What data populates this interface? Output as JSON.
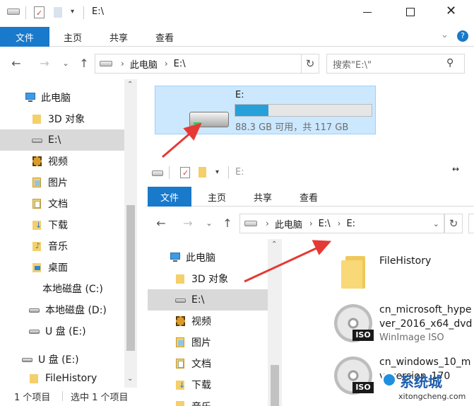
{
  "back_window": {
    "title": "E:\\",
    "tabs": [
      "文件",
      "主页",
      "共享",
      "查看"
    ],
    "address": [
      "此电脑",
      "E:\\"
    ],
    "search_placeholder": "搜索\"E:\\\"",
    "tree": [
      {
        "label": "此电脑",
        "icon": "computer-icon"
      },
      {
        "label": "3D 对象",
        "icon": "3d-objects-folder-icon"
      },
      {
        "label": "E:\\",
        "icon": "drive-icon",
        "selected": true
      },
      {
        "label": "视频",
        "icon": "videos-folder-icon"
      },
      {
        "label": "图片",
        "icon": "pictures-folder-icon"
      },
      {
        "label": "文档",
        "icon": "documents-folder-icon"
      },
      {
        "label": "下载",
        "icon": "downloads-folder-icon"
      },
      {
        "label": "音乐",
        "icon": "music-folder-icon"
      },
      {
        "label": "桌面",
        "icon": "desktop-folder-icon"
      },
      {
        "label": "本地磁盘 (C:)",
        "icon": "windows-drive-icon"
      },
      {
        "label": "本地磁盘 (D:)",
        "icon": "drive-icon"
      },
      {
        "label": "U 盘 (E:)",
        "icon": "usb-drive-icon"
      },
      {
        "label": "U 盘 (E:)",
        "icon": "usb-drive-icon"
      },
      {
        "label": "FileHistory",
        "icon": "folder-icon"
      }
    ],
    "drive_tile": {
      "name": "E:",
      "usage_text": "88.3 GB 可用，共 117 GB",
      "used_fraction": 0.245
    },
    "status_count": "1 个项目",
    "status_selected": "选中 1 个项目"
  },
  "front_window": {
    "title": "E:",
    "tabs": [
      "文件",
      "主页",
      "共享",
      "查看"
    ],
    "address": [
      "此电脑",
      "E:\\",
      "E:"
    ],
    "tree": [
      {
        "label": "此电脑",
        "icon": "computer-icon"
      },
      {
        "label": "3D 对象",
        "icon": "3d-objects-folder-icon"
      },
      {
        "label": "E:\\",
        "icon": "drive-icon",
        "selected": true
      },
      {
        "label": "视频",
        "icon": "videos-folder-icon"
      },
      {
        "label": "图片",
        "icon": "pictures-folder-icon"
      },
      {
        "label": "文档",
        "icon": "documents-folder-icon"
      },
      {
        "label": "下载",
        "icon": "downloads-folder-icon"
      },
      {
        "label": "音乐",
        "icon": "music-folder-icon"
      }
    ],
    "files": [
      {
        "name": "FileHistory",
        "sub": "",
        "icon": "folder-icon"
      },
      {
        "name": "cn_microsoft_hype",
        "name2": "ver_2016_x64_dvd",
        "sub": "WinImage ISO",
        "icon": "iso-disc-icon"
      },
      {
        "name": "cn_windows_10_m",
        "name2": "v_version_170",
        "sub": "",
        "icon": "iso-disc-icon"
      }
    ]
  },
  "watermark": {
    "text": "系统城",
    "url": "xitongcheng.com"
  },
  "colors": {
    "accent": "#1979ca",
    "selection": "#cce8ff",
    "arrow": "#e53935",
    "bar": "#26a0da"
  }
}
